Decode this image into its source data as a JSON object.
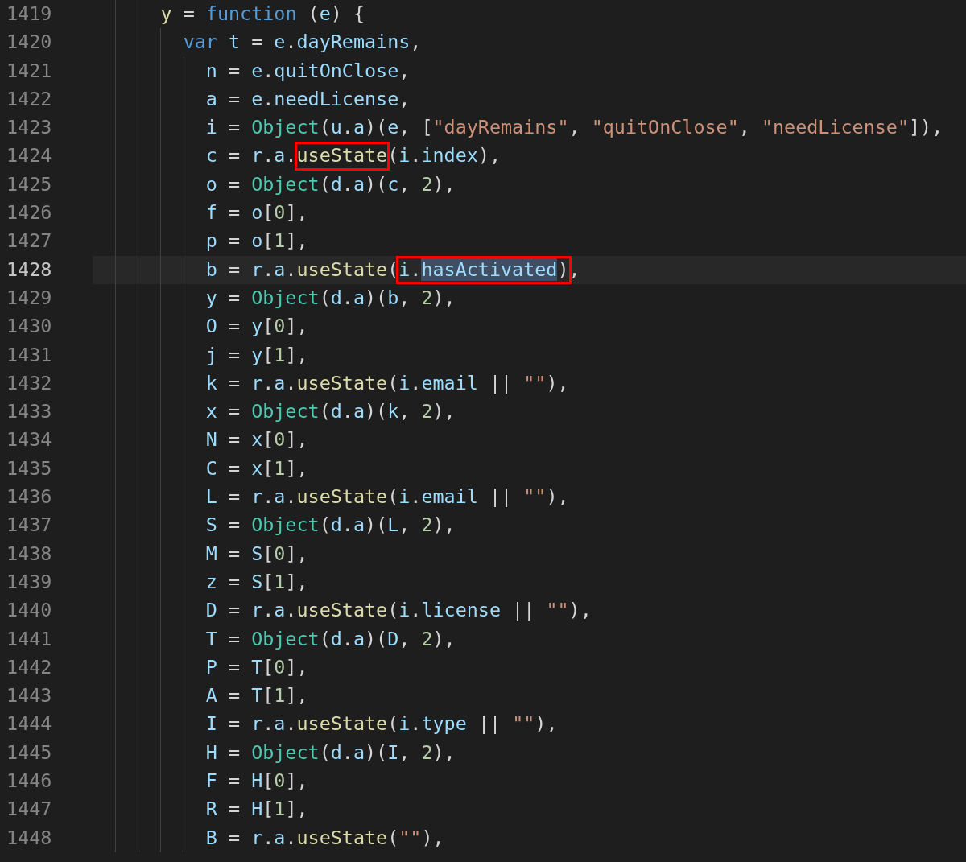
{
  "editor": {
    "lines": [
      {
        "number": "1419",
        "current": false,
        "tokens": [
          {
            "kind": "fn",
            "text": "y"
          },
          {
            "kind": "pun",
            "text": " = "
          },
          {
            "kind": "kw",
            "text": "function"
          },
          {
            "kind": "pun",
            "text": " ("
          },
          {
            "kind": "var",
            "text": "e"
          },
          {
            "kind": "pun",
            "text": ") {"
          }
        ],
        "children": [
          {
            "number": "1420",
            "current": false,
            "tokens": [
              {
                "kind": "kw",
                "text": "var "
              },
              {
                "kind": "var",
                "text": "t"
              },
              {
                "kind": "pun",
                "text": " = "
              },
              {
                "kind": "var",
                "text": "e"
              },
              {
                "kind": "pun",
                "text": "."
              },
              {
                "kind": "prop",
                "text": "dayRemains"
              },
              {
                "kind": "pun",
                "text": ","
              }
            ],
            "children": [
              {
                "number": "1421",
                "current": false,
                "tokens": [
                  {
                    "kind": "var",
                    "text": "n"
                  },
                  {
                    "kind": "pun",
                    "text": " = "
                  },
                  {
                    "kind": "var",
                    "text": "e"
                  },
                  {
                    "kind": "pun",
                    "text": "."
                  },
                  {
                    "kind": "prop",
                    "text": "quitOnClose"
                  },
                  {
                    "kind": "pun",
                    "text": ","
                  }
                ]
              },
              {
                "number": "1422",
                "current": false,
                "tokens": [
                  {
                    "kind": "var",
                    "text": "a"
                  },
                  {
                    "kind": "pun",
                    "text": " = "
                  },
                  {
                    "kind": "var",
                    "text": "e"
                  },
                  {
                    "kind": "pun",
                    "text": "."
                  },
                  {
                    "kind": "prop",
                    "text": "needLicense"
                  },
                  {
                    "kind": "pun",
                    "text": ","
                  }
                ]
              },
              {
                "number": "1423",
                "current": false,
                "tokens": [
                  {
                    "kind": "var",
                    "text": "i"
                  },
                  {
                    "kind": "pun",
                    "text": " = "
                  },
                  {
                    "kind": "cls",
                    "text": "Object"
                  },
                  {
                    "kind": "pun",
                    "text": "("
                  },
                  {
                    "kind": "var",
                    "text": "u"
                  },
                  {
                    "kind": "pun",
                    "text": "."
                  },
                  {
                    "kind": "var",
                    "text": "a"
                  },
                  {
                    "kind": "pun",
                    "text": ")("
                  },
                  {
                    "kind": "var",
                    "text": "e"
                  },
                  {
                    "kind": "pun",
                    "text": ", ["
                  },
                  {
                    "kind": "str",
                    "text": "\"dayRemains\""
                  },
                  {
                    "kind": "pun",
                    "text": ", "
                  },
                  {
                    "kind": "str",
                    "text": "\"quitOnClose\""
                  },
                  {
                    "kind": "pun",
                    "text": ", "
                  },
                  {
                    "kind": "str",
                    "text": "\"needLicense\""
                  },
                  {
                    "kind": "pun",
                    "text": "]),"
                  }
                ]
              },
              {
                "number": "1424",
                "current": false,
                "tokens": [
                  {
                    "kind": "var",
                    "text": "c"
                  },
                  {
                    "kind": "pun",
                    "text": " = "
                  },
                  {
                    "kind": "var",
                    "text": "r"
                  },
                  {
                    "kind": "pun",
                    "text": "."
                  },
                  {
                    "kind": "var",
                    "text": "a"
                  },
                  {
                    "kind": "pun",
                    "text": "."
                  },
                  {
                    "kind": "fn",
                    "text": "useState",
                    "boxed": true
                  },
                  {
                    "kind": "pun",
                    "text": "("
                  },
                  {
                    "kind": "var",
                    "text": "i"
                  },
                  {
                    "kind": "pun",
                    "text": "."
                  },
                  {
                    "kind": "prop",
                    "text": "index"
                  },
                  {
                    "kind": "pun",
                    "text": "),"
                  }
                ]
              },
              {
                "number": "1425",
                "current": false,
                "tokens": [
                  {
                    "kind": "var",
                    "text": "o"
                  },
                  {
                    "kind": "pun",
                    "text": " = "
                  },
                  {
                    "kind": "cls",
                    "text": "Object"
                  },
                  {
                    "kind": "pun",
                    "text": "("
                  },
                  {
                    "kind": "var",
                    "text": "d"
                  },
                  {
                    "kind": "pun",
                    "text": "."
                  },
                  {
                    "kind": "var",
                    "text": "a"
                  },
                  {
                    "kind": "pun",
                    "text": ")("
                  },
                  {
                    "kind": "var",
                    "text": "c"
                  },
                  {
                    "kind": "pun",
                    "text": ", "
                  },
                  {
                    "kind": "num",
                    "text": "2"
                  },
                  {
                    "kind": "pun",
                    "text": "),"
                  }
                ]
              },
              {
                "number": "1426",
                "current": false,
                "tokens": [
                  {
                    "kind": "var",
                    "text": "f"
                  },
                  {
                    "kind": "pun",
                    "text": " = "
                  },
                  {
                    "kind": "var",
                    "text": "o"
                  },
                  {
                    "kind": "pun",
                    "text": "["
                  },
                  {
                    "kind": "num",
                    "text": "0"
                  },
                  {
                    "kind": "pun",
                    "text": "],"
                  }
                ]
              },
              {
                "number": "1427",
                "current": false,
                "tokens": [
                  {
                    "kind": "var",
                    "text": "p"
                  },
                  {
                    "kind": "pun",
                    "text": " = "
                  },
                  {
                    "kind": "var",
                    "text": "o"
                  },
                  {
                    "kind": "pun",
                    "text": "["
                  },
                  {
                    "kind": "num",
                    "text": "1"
                  },
                  {
                    "kind": "pun",
                    "text": "],"
                  }
                ]
              },
              {
                "number": "1428",
                "current": true,
                "tokens": [
                  {
                    "kind": "var",
                    "text": "b"
                  },
                  {
                    "kind": "pun",
                    "text": " = "
                  },
                  {
                    "kind": "var",
                    "text": "r"
                  },
                  {
                    "kind": "pun",
                    "text": "."
                  },
                  {
                    "kind": "var",
                    "text": "a"
                  },
                  {
                    "kind": "pun",
                    "text": "."
                  },
                  {
                    "kind": "fn",
                    "text": "useState"
                  },
                  {
                    "kind": "pun",
                    "text": "("
                  },
                  {
                    "kind": "var",
                    "text": "i",
                    "boxed": true
                  },
                  {
                    "kind": "pun",
                    "text": ".",
                    "boxed": true
                  },
                  {
                    "kind": "prop",
                    "text": "hasActivated",
                    "boxed": true,
                    "highlighted": true
                  },
                  {
                    "kind": "pun",
                    "text": ")",
                    "boxed": true
                  },
                  {
                    "kind": "pun",
                    "text": ","
                  }
                ]
              },
              {
                "number": "1429",
                "current": false,
                "tokens": [
                  {
                    "kind": "var",
                    "text": "y"
                  },
                  {
                    "kind": "pun",
                    "text": " = "
                  },
                  {
                    "kind": "cls",
                    "text": "Object"
                  },
                  {
                    "kind": "pun",
                    "text": "("
                  },
                  {
                    "kind": "var",
                    "text": "d"
                  },
                  {
                    "kind": "pun",
                    "text": "."
                  },
                  {
                    "kind": "var",
                    "text": "a"
                  },
                  {
                    "kind": "pun",
                    "text": ")("
                  },
                  {
                    "kind": "var",
                    "text": "b"
                  },
                  {
                    "kind": "pun",
                    "text": ", "
                  },
                  {
                    "kind": "num",
                    "text": "2"
                  },
                  {
                    "kind": "pun",
                    "text": "),"
                  }
                ]
              },
              {
                "number": "1430",
                "current": false,
                "tokens": [
                  {
                    "kind": "var",
                    "text": "O"
                  },
                  {
                    "kind": "pun",
                    "text": " = "
                  },
                  {
                    "kind": "var",
                    "text": "y"
                  },
                  {
                    "kind": "pun",
                    "text": "["
                  },
                  {
                    "kind": "num",
                    "text": "0"
                  },
                  {
                    "kind": "pun",
                    "text": "],"
                  }
                ]
              },
              {
                "number": "1431",
                "current": false,
                "tokens": [
                  {
                    "kind": "var",
                    "text": "j"
                  },
                  {
                    "kind": "pun",
                    "text": " = "
                  },
                  {
                    "kind": "var",
                    "text": "y"
                  },
                  {
                    "kind": "pun",
                    "text": "["
                  },
                  {
                    "kind": "num",
                    "text": "1"
                  },
                  {
                    "kind": "pun",
                    "text": "],"
                  }
                ]
              },
              {
                "number": "1432",
                "current": false,
                "tokens": [
                  {
                    "kind": "var",
                    "text": "k"
                  },
                  {
                    "kind": "pun",
                    "text": " = "
                  },
                  {
                    "kind": "var",
                    "text": "r"
                  },
                  {
                    "kind": "pun",
                    "text": "."
                  },
                  {
                    "kind": "var",
                    "text": "a"
                  },
                  {
                    "kind": "pun",
                    "text": "."
                  },
                  {
                    "kind": "fn",
                    "text": "useState"
                  },
                  {
                    "kind": "pun",
                    "text": "("
                  },
                  {
                    "kind": "var",
                    "text": "i"
                  },
                  {
                    "kind": "pun",
                    "text": "."
                  },
                  {
                    "kind": "prop",
                    "text": "email"
                  },
                  {
                    "kind": "pun",
                    "text": " || "
                  },
                  {
                    "kind": "str",
                    "text": "\"\""
                  },
                  {
                    "kind": "pun",
                    "text": "),"
                  }
                ]
              },
              {
                "number": "1433",
                "current": false,
                "tokens": [
                  {
                    "kind": "var",
                    "text": "x"
                  },
                  {
                    "kind": "pun",
                    "text": " = "
                  },
                  {
                    "kind": "cls",
                    "text": "Object"
                  },
                  {
                    "kind": "pun",
                    "text": "("
                  },
                  {
                    "kind": "var",
                    "text": "d"
                  },
                  {
                    "kind": "pun",
                    "text": "."
                  },
                  {
                    "kind": "var",
                    "text": "a"
                  },
                  {
                    "kind": "pun",
                    "text": ")("
                  },
                  {
                    "kind": "var",
                    "text": "k"
                  },
                  {
                    "kind": "pun",
                    "text": ", "
                  },
                  {
                    "kind": "num",
                    "text": "2"
                  },
                  {
                    "kind": "pun",
                    "text": "),"
                  }
                ]
              },
              {
                "number": "1434",
                "current": false,
                "tokens": [
                  {
                    "kind": "var",
                    "text": "N"
                  },
                  {
                    "kind": "pun",
                    "text": " = "
                  },
                  {
                    "kind": "var",
                    "text": "x"
                  },
                  {
                    "kind": "pun",
                    "text": "["
                  },
                  {
                    "kind": "num",
                    "text": "0"
                  },
                  {
                    "kind": "pun",
                    "text": "],"
                  }
                ]
              },
              {
                "number": "1435",
                "current": false,
                "tokens": [
                  {
                    "kind": "var",
                    "text": "C"
                  },
                  {
                    "kind": "pun",
                    "text": " = "
                  },
                  {
                    "kind": "var",
                    "text": "x"
                  },
                  {
                    "kind": "pun",
                    "text": "["
                  },
                  {
                    "kind": "num",
                    "text": "1"
                  },
                  {
                    "kind": "pun",
                    "text": "],"
                  }
                ]
              },
              {
                "number": "1436",
                "current": false,
                "tokens": [
                  {
                    "kind": "var",
                    "text": "L"
                  },
                  {
                    "kind": "pun",
                    "text": " = "
                  },
                  {
                    "kind": "var",
                    "text": "r"
                  },
                  {
                    "kind": "pun",
                    "text": "."
                  },
                  {
                    "kind": "var",
                    "text": "a"
                  },
                  {
                    "kind": "pun",
                    "text": "."
                  },
                  {
                    "kind": "fn",
                    "text": "useState"
                  },
                  {
                    "kind": "pun",
                    "text": "("
                  },
                  {
                    "kind": "var",
                    "text": "i"
                  },
                  {
                    "kind": "pun",
                    "text": "."
                  },
                  {
                    "kind": "prop",
                    "text": "email"
                  },
                  {
                    "kind": "pun",
                    "text": " || "
                  },
                  {
                    "kind": "str",
                    "text": "\"\""
                  },
                  {
                    "kind": "pun",
                    "text": "),"
                  }
                ]
              },
              {
                "number": "1437",
                "current": false,
                "tokens": [
                  {
                    "kind": "var",
                    "text": "S"
                  },
                  {
                    "kind": "pun",
                    "text": " = "
                  },
                  {
                    "kind": "cls",
                    "text": "Object"
                  },
                  {
                    "kind": "pun",
                    "text": "("
                  },
                  {
                    "kind": "var",
                    "text": "d"
                  },
                  {
                    "kind": "pun",
                    "text": "."
                  },
                  {
                    "kind": "var",
                    "text": "a"
                  },
                  {
                    "kind": "pun",
                    "text": ")("
                  },
                  {
                    "kind": "var",
                    "text": "L"
                  },
                  {
                    "kind": "pun",
                    "text": ", "
                  },
                  {
                    "kind": "num",
                    "text": "2"
                  },
                  {
                    "kind": "pun",
                    "text": "),"
                  }
                ]
              },
              {
                "number": "1438",
                "current": false,
                "tokens": [
                  {
                    "kind": "var",
                    "text": "M"
                  },
                  {
                    "kind": "pun",
                    "text": " = "
                  },
                  {
                    "kind": "var",
                    "text": "S"
                  },
                  {
                    "kind": "pun",
                    "text": "["
                  },
                  {
                    "kind": "num",
                    "text": "0"
                  },
                  {
                    "kind": "pun",
                    "text": "],"
                  }
                ]
              },
              {
                "number": "1439",
                "current": false,
                "tokens": [
                  {
                    "kind": "var",
                    "text": "z"
                  },
                  {
                    "kind": "pun",
                    "text": " = "
                  },
                  {
                    "kind": "var",
                    "text": "S"
                  },
                  {
                    "kind": "pun",
                    "text": "["
                  },
                  {
                    "kind": "num",
                    "text": "1"
                  },
                  {
                    "kind": "pun",
                    "text": "],"
                  }
                ]
              },
              {
                "number": "1440",
                "current": false,
                "tokens": [
                  {
                    "kind": "var",
                    "text": "D"
                  },
                  {
                    "kind": "pun",
                    "text": " = "
                  },
                  {
                    "kind": "var",
                    "text": "r"
                  },
                  {
                    "kind": "pun",
                    "text": "."
                  },
                  {
                    "kind": "var",
                    "text": "a"
                  },
                  {
                    "kind": "pun",
                    "text": "."
                  },
                  {
                    "kind": "fn",
                    "text": "useState"
                  },
                  {
                    "kind": "pun",
                    "text": "("
                  },
                  {
                    "kind": "var",
                    "text": "i"
                  },
                  {
                    "kind": "pun",
                    "text": "."
                  },
                  {
                    "kind": "prop",
                    "text": "license"
                  },
                  {
                    "kind": "pun",
                    "text": " || "
                  },
                  {
                    "kind": "str",
                    "text": "\"\""
                  },
                  {
                    "kind": "pun",
                    "text": "),"
                  }
                ]
              },
              {
                "number": "1441",
                "current": false,
                "tokens": [
                  {
                    "kind": "var",
                    "text": "T"
                  },
                  {
                    "kind": "pun",
                    "text": " = "
                  },
                  {
                    "kind": "cls",
                    "text": "Object"
                  },
                  {
                    "kind": "pun",
                    "text": "("
                  },
                  {
                    "kind": "var",
                    "text": "d"
                  },
                  {
                    "kind": "pun",
                    "text": "."
                  },
                  {
                    "kind": "var",
                    "text": "a"
                  },
                  {
                    "kind": "pun",
                    "text": ")("
                  },
                  {
                    "kind": "var",
                    "text": "D"
                  },
                  {
                    "kind": "pun",
                    "text": ", "
                  },
                  {
                    "kind": "num",
                    "text": "2"
                  },
                  {
                    "kind": "pun",
                    "text": "),"
                  }
                ]
              },
              {
                "number": "1442",
                "current": false,
                "tokens": [
                  {
                    "kind": "var",
                    "text": "P"
                  },
                  {
                    "kind": "pun",
                    "text": " = "
                  },
                  {
                    "kind": "var",
                    "text": "T"
                  },
                  {
                    "kind": "pun",
                    "text": "["
                  },
                  {
                    "kind": "num",
                    "text": "0"
                  },
                  {
                    "kind": "pun",
                    "text": "],"
                  }
                ]
              },
              {
                "number": "1443",
                "current": false,
                "tokens": [
                  {
                    "kind": "var",
                    "text": "A"
                  },
                  {
                    "kind": "pun",
                    "text": " = "
                  },
                  {
                    "kind": "var",
                    "text": "T"
                  },
                  {
                    "kind": "pun",
                    "text": "["
                  },
                  {
                    "kind": "num",
                    "text": "1"
                  },
                  {
                    "kind": "pun",
                    "text": "],"
                  }
                ]
              },
              {
                "number": "1444",
                "current": false,
                "tokens": [
                  {
                    "kind": "var",
                    "text": "I"
                  },
                  {
                    "kind": "pun",
                    "text": " = "
                  },
                  {
                    "kind": "var",
                    "text": "r"
                  },
                  {
                    "kind": "pun",
                    "text": "."
                  },
                  {
                    "kind": "var",
                    "text": "a"
                  },
                  {
                    "kind": "pun",
                    "text": "."
                  },
                  {
                    "kind": "fn",
                    "text": "useState"
                  },
                  {
                    "kind": "pun",
                    "text": "("
                  },
                  {
                    "kind": "var",
                    "text": "i"
                  },
                  {
                    "kind": "pun",
                    "text": "."
                  },
                  {
                    "kind": "prop",
                    "text": "type"
                  },
                  {
                    "kind": "pun",
                    "text": " || "
                  },
                  {
                    "kind": "str",
                    "text": "\"\""
                  },
                  {
                    "kind": "pun",
                    "text": "),"
                  }
                ]
              },
              {
                "number": "1445",
                "current": false,
                "tokens": [
                  {
                    "kind": "var",
                    "text": "H"
                  },
                  {
                    "kind": "pun",
                    "text": " = "
                  },
                  {
                    "kind": "cls",
                    "text": "Object"
                  },
                  {
                    "kind": "pun",
                    "text": "("
                  },
                  {
                    "kind": "var",
                    "text": "d"
                  },
                  {
                    "kind": "pun",
                    "text": "."
                  },
                  {
                    "kind": "var",
                    "text": "a"
                  },
                  {
                    "kind": "pun",
                    "text": ")("
                  },
                  {
                    "kind": "var",
                    "text": "I"
                  },
                  {
                    "kind": "pun",
                    "text": ", "
                  },
                  {
                    "kind": "num",
                    "text": "2"
                  },
                  {
                    "kind": "pun",
                    "text": "),"
                  }
                ]
              },
              {
                "number": "1446",
                "current": false,
                "tokens": [
                  {
                    "kind": "var",
                    "text": "F"
                  },
                  {
                    "kind": "pun",
                    "text": " = "
                  },
                  {
                    "kind": "var",
                    "text": "H"
                  },
                  {
                    "kind": "pun",
                    "text": "["
                  },
                  {
                    "kind": "num",
                    "text": "0"
                  },
                  {
                    "kind": "pun",
                    "text": "],"
                  }
                ]
              },
              {
                "number": "1447",
                "current": false,
                "tokens": [
                  {
                    "kind": "var",
                    "text": "R"
                  },
                  {
                    "kind": "pun",
                    "text": " = "
                  },
                  {
                    "kind": "var",
                    "text": "H"
                  },
                  {
                    "kind": "pun",
                    "text": "["
                  },
                  {
                    "kind": "num",
                    "text": "1"
                  },
                  {
                    "kind": "pun",
                    "text": "],"
                  }
                ]
              },
              {
                "number": "1448",
                "current": false,
                "tokens": [
                  {
                    "kind": "var",
                    "text": "B"
                  },
                  {
                    "kind": "pun",
                    "text": " = "
                  },
                  {
                    "kind": "var",
                    "text": "r"
                  },
                  {
                    "kind": "pun",
                    "text": "."
                  },
                  {
                    "kind": "var",
                    "text": "a"
                  },
                  {
                    "kind": "pun",
                    "text": "."
                  },
                  {
                    "kind": "fn",
                    "text": "useState"
                  },
                  {
                    "kind": "pun",
                    "text": "("
                  },
                  {
                    "kind": "str",
                    "text": "\"\""
                  },
                  {
                    "kind": "pun",
                    "text": "),"
                  }
                ]
              }
            ]
          }
        ]
      }
    ]
  }
}
